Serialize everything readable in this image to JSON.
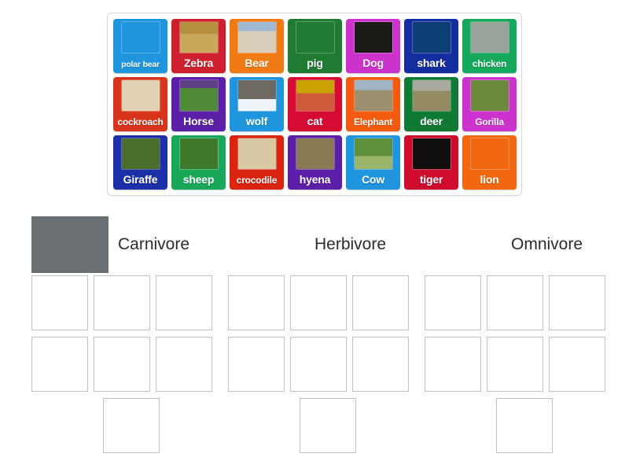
{
  "activity": {
    "type": "group-sort",
    "title": "Animal diet group sort"
  },
  "tile_bank": {
    "name": "tile-bank",
    "rows": [
      [
        {
          "label": "polar bear",
          "color": "#1e95dd",
          "thumb": "polar-bear-photo",
          "size": "tiny"
        },
        {
          "label": "Zebra",
          "color": "#cf2030",
          "thumb": "zebra-photo",
          "size": "normal"
        },
        {
          "label": "Bear",
          "color": "#f07b14",
          "thumb": "bear-photo",
          "size": "normal"
        },
        {
          "label": "pig",
          "color": "#1f7a32",
          "thumb": "pig-photo",
          "size": "normal"
        },
        {
          "label": "Dog",
          "color": "#cc33cc",
          "thumb": "dog-photo",
          "size": "normal"
        },
        {
          "label": "shark",
          "color": "#142ea0",
          "thumb": "shark-photo",
          "size": "normal"
        },
        {
          "label": "chicken",
          "color": "#16a85c",
          "thumb": "chicken-photo",
          "size": "small"
        }
      ],
      [
        {
          "label": "cockroach",
          "color": "#d8341b",
          "thumb": "cockroach-photo",
          "size": "small"
        },
        {
          "label": "Horse",
          "color": "#5b1fa8",
          "thumb": "horse-photo",
          "size": "normal"
        },
        {
          "label": "wolf",
          "color": "#1e95dd",
          "thumb": "wolf-photo",
          "size": "normal"
        },
        {
          "label": "cat",
          "color": "#d60b34",
          "thumb": "cat-photo",
          "size": "normal"
        },
        {
          "label": "Elephant",
          "color": "#f25b10",
          "thumb": "elephant-photo",
          "size": "small"
        },
        {
          "label": "deer",
          "color": "#0f7a34",
          "thumb": "deer-photo",
          "size": "normal"
        },
        {
          "label": "Gorilla",
          "color": "#cc33cc",
          "thumb": "gorilla-photo",
          "size": "small"
        }
      ],
      [
        {
          "label": "Giraffe",
          "color": "#1b2fa8",
          "thumb": "giraffe-photo",
          "size": "normal"
        },
        {
          "label": "sheep",
          "color": "#19a85a",
          "thumb": "sheep-photo",
          "size": "normal"
        },
        {
          "label": "crocodile",
          "color": "#db2410",
          "thumb": "crocodile-photo",
          "size": "small"
        },
        {
          "label": "hyena",
          "color": "#5e1fa8",
          "thumb": "hyena-photo",
          "size": "normal"
        },
        {
          "label": "Cow",
          "color": "#1e95dd",
          "thumb": "cow-photo",
          "size": "normal"
        },
        {
          "label": "tiger",
          "color": "#cf0b2e",
          "thumb": "tiger-photo",
          "size": "normal"
        },
        {
          "label": "lion",
          "color": "#f26811",
          "thumb": "lion-photo",
          "size": "normal"
        }
      ]
    ]
  },
  "categories": [
    {
      "label": "Carnivore",
      "thumb": "raw-meat-photo",
      "slot_rows": [
        3,
        3,
        1
      ]
    },
    {
      "label": "Herbivore",
      "thumb": "vegetables-basket-photo",
      "slot_rows": [
        3,
        3,
        1
      ]
    },
    {
      "label": "Omnivore",
      "thumb": "mixed-vegetables-photo",
      "slot_rows": [
        3,
        3,
        1
      ]
    }
  ]
}
